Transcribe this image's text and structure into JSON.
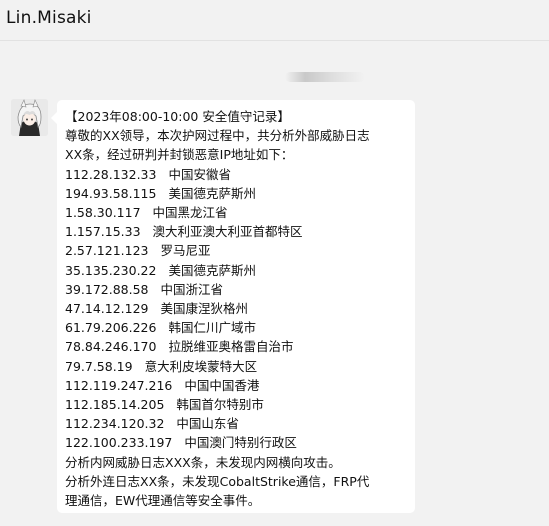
{
  "chat": {
    "title": "Lin.Misaki"
  },
  "message": {
    "header": "【2023年08:00-10:00 安全值守记录】",
    "intro": [
      "尊敬的XX领导，本次护网过程中，共分析外部威胁日志",
      "XX条，经过研判并封锁恶意IP地址如下："
    ],
    "ips": [
      {
        "ip": "112.28.132.33",
        "location": "中国安徽省"
      },
      {
        "ip": "194.93.58.115",
        "location": "美国德克萨斯州"
      },
      {
        "ip": "1.58.30.117",
        "location": "中国黑龙江省"
      },
      {
        "ip": "1.157.15.33",
        "location": "澳大利亚澳大利亚首都特区"
      },
      {
        "ip": "2.57.121.123",
        "location": "罗马尼亚"
      },
      {
        "ip": "35.135.230.22",
        "location": "美国德克萨斯州"
      },
      {
        "ip": "39.172.88.58",
        "location": "中国浙江省"
      },
      {
        "ip": "47.14.12.129",
        "location": "美国康涅狄格州"
      },
      {
        "ip": "61.79.206.226",
        "location": "韩国仁川广域市"
      },
      {
        "ip": "78.84.246.170",
        "location": "拉脱维亚奥格雷自治市"
      },
      {
        "ip": "79.7.58.19",
        "location": "意大利皮埃蒙特大区"
      },
      {
        "ip": "112.119.247.216",
        "location": "中国中国香港"
      },
      {
        "ip": "112.185.14.205",
        "location": "韩国首尔特别市"
      },
      {
        "ip": "112.234.120.32",
        "location": "中国山东省"
      },
      {
        "ip": "122.100.233.197",
        "location": "中国澳门特别行政区"
      }
    ],
    "footer": [
      "分析内网威胁日志XXX条，未发现内网横向攻击。",
      "分析外连日志XX条，未发现CobaltStrike通信，FRP代",
      "理通信，EW代理通信等安全事件。"
    ]
  }
}
